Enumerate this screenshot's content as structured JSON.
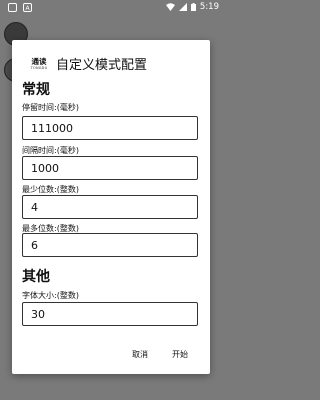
{
  "status_bar": {
    "app_icon_1": "",
    "app_icon_2": "A",
    "time": "5:19"
  },
  "dialog": {
    "logo_line1": "通读",
    "logo_line2": "TONGDU",
    "title": "自定义模式配置",
    "sections": {
      "general": "常规",
      "other": "其他"
    },
    "fields": [
      {
        "label": "停留时间:(毫秒)",
        "value": "111000"
      },
      {
        "label": "间隔时间:(毫秒)",
        "value": "1000"
      },
      {
        "label": "最少位数:(整数)",
        "value": "4"
      },
      {
        "label": "最多位数:(整数)",
        "value": "6"
      },
      {
        "label": "字体大小:(整数)",
        "value": "30"
      }
    ],
    "cancel_label": "取消",
    "start_label": "开始"
  }
}
